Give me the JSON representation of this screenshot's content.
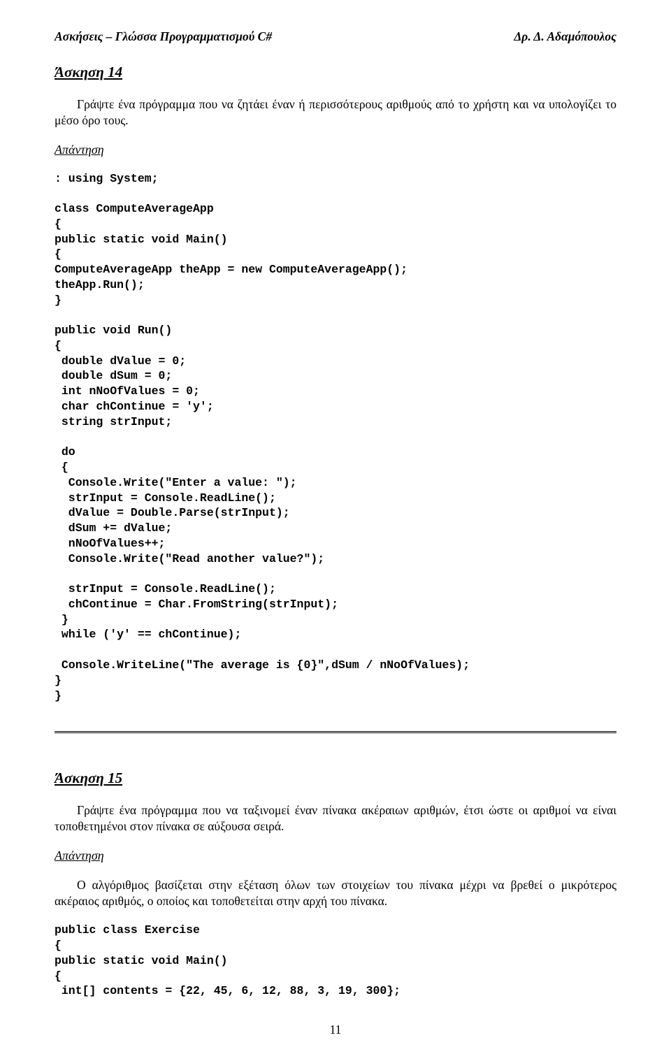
{
  "header": {
    "left": "Ασκήσεις – Γλώσσα Προγραμματισμού C#",
    "right": "Δρ. Δ. Αδαμόπουλος"
  },
  "ex14": {
    "title": "Άσκηση 14",
    "prompt": "Γράψτε ένα πρόγραμμα που να ζητάει έναν ή περισσότερους αριθμούς από το χρήστη και να υπολογίζει το μέσο όρο τους.",
    "answer_label": "Απάντηση",
    "code": ": using System;\n\nclass ComputeAverageApp\n{\npublic static void Main()\n{\nComputeAverageApp theApp = new ComputeAverageApp();\ntheApp.Run();\n}\n\npublic void Run()\n{\n double dValue = 0;\n double dSum = 0;\n int nNoOfValues = 0;\n char chContinue = 'y';\n string strInput;\n\n do\n {\n  Console.Write(\"Enter a value: \");\n  strInput = Console.ReadLine();\n  dValue = Double.Parse(strInput);\n  dSum += dValue;\n  nNoOfValues++;\n  Console.Write(\"Read another value?\");\n\n  strInput = Console.ReadLine();\n  chContinue = Char.FromString(strInput);\n }\n while ('y' == chContinue);\n\n Console.WriteLine(\"The average is {0}\",dSum / nNoOfValues);\n}\n}"
  },
  "ex15": {
    "title": "Άσκηση 15",
    "prompt": "Γράψτε ένα πρόγραμμα που να ταξινομεί έναν πίνακα ακέραιων αριθμών, έτσι ώστε οι αριθμοί να είναι τοποθετημένοι στον πίνακα σε αύξουσα σειρά.",
    "answer_label": "Απάντηση",
    "explanation": "Ο αλγόριθμος βασίζεται στην εξέταση όλων των στοιχείων του πίνακα μέχρι να βρεθεί ο μικρότερος ακέραιος αριθμός, ο οποίος και τοποθετείται στην αρχή του πίνακα.",
    "code": "public class Exercise\n{\npublic static void Main()\n{\n int[] contents = {22, 45, 6, 12, 88, 3, 19, 300};"
  },
  "page_number": "11"
}
